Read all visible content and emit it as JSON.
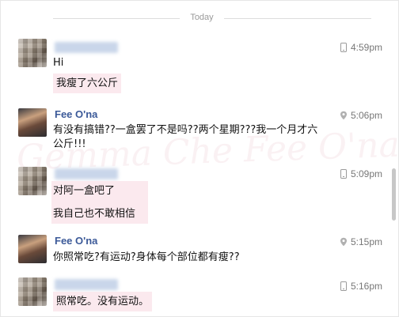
{
  "date_separator": "Today",
  "watermark": "Gemma Che Fee O'na",
  "messages": [
    {
      "sender": "",
      "time": "4:59pm",
      "time_icon": "phone-icon",
      "lines": [
        "Hi",
        "我瘦了六公斤"
      ]
    },
    {
      "sender": "Fee O'na",
      "time": "5:06pm",
      "time_icon": "location-pin-icon",
      "lines": [
        "有没有搞错??一盒罢了不是吗??两个星期???我一个月才六",
        "公斤!!!"
      ]
    },
    {
      "sender": "",
      "time": "5:09pm",
      "time_icon": "phone-icon",
      "lines": [
        "对阿一盒吧了",
        "我自己也不敢相信"
      ]
    },
    {
      "sender": "Fee O'na",
      "time": "5:15pm",
      "time_icon": "location-pin-icon",
      "lines": [
        "你照常吃?有运动?身体每个部位都有瘦??"
      ]
    },
    {
      "sender": "",
      "time": "5:16pm",
      "time_icon": "phone-icon",
      "lines": [
        "照常吃。没有运动。"
      ]
    }
  ],
  "colors": {
    "name": "#3b5998",
    "highlight": "#fbe9ee",
    "time": "#777777"
  }
}
